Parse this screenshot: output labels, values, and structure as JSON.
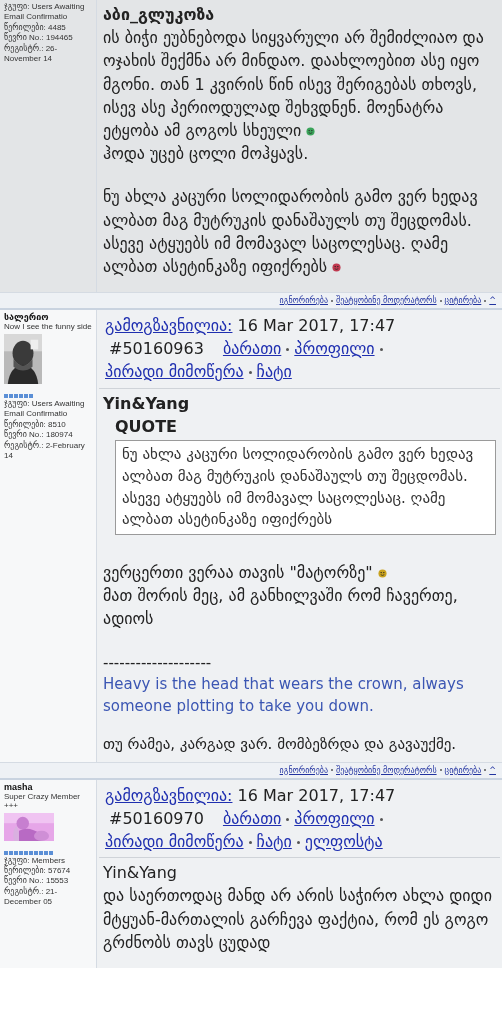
{
  "posts": [
    {
      "stats": [
        "ჯგუფი: Users Awaiting Email Confirmatio",
        "წერილები: 4485",
        "წევრი No.: 194465",
        "რეგისტრ.: 26-November 14"
      ],
      "blocks": [
        {
          "kind": "name",
          "text": "აბი_გლუკოზა"
        },
        {
          "kind": "text",
          "parts": [
            {
              "kind": "text",
              "text": "ის ბიჭი ეუბნებოდა სიყვარული არ შემიძლიაო და ოჯახის შექმნა არ მინდაო. დაახლოებით ასე იყო მგონი. თან 1 კვირის წინ ისევ შერიგებას თხოვს, ისევ ასე პერიოდულად შეხვდნენ. მოენატრა ეტყობა ამ გოგოს სხეული "
            },
            {
              "kind": "emoticon",
              "color": "#3aa35a"
            },
            {
              "kind": "break"
            },
            {
              "kind": "text",
              "text": "ჰოდა უცებ ცოლი მოჰყავს."
            }
          ]
        },
        {
          "kind": "text",
          "parts": [
            {
              "kind": "text",
              "text": "ნუ ახლა კაცური სოლიდარობის გამო ვერ ხედავ ალბათ მაგ მუტრუკის დანაშაულს თუ შეცდომას. ასევე ატყუებს იმ მომავალ საცოლესაც. ღამე ალბათ ასეტინკაზე იფიქრებს "
            },
            {
              "kind": "emoticon",
              "color": "#c0394f"
            }
          ]
        }
      ],
      "footer": [
        "იგნორირება",
        "შეატყობინე მოდერატორს",
        "ციტირება",
        "^"
      ]
    },
    {
      "author": "სალერიო",
      "member_title": "Now I see the funny side",
      "avatar": {
        "kind": "picture"
      },
      "stars": 6,
      "stats": [
        "ჯგუფი: Users Awaiting Email Confirmatio",
        "წერილები: 8510",
        "წევრი No.: 180974",
        "რეგისტრ.: 2-February 14"
      ],
      "header": {
        "label": "გამოგზავნილია:",
        "date": "16 Mar 2017, 17:47",
        "number": "#50160963",
        "links": [
          "ბარათი",
          "პროფილი",
          "პირადი მიმოწერა",
          "ჩატი"
        ]
      },
      "blocks": [
        {
          "kind": "name",
          "text": "Yin&Yang"
        },
        {
          "kind": "quote",
          "label": "QUOTE",
          "text": "ნუ ახლა კაცური სოლიდარობის გამო ვერ ხედავ ალბათ მაგ მუტრუკის დანაშაულს თუ შეცდომას. ასევე ატყუებს იმ მომავალ საცოლესაც. ღამე ალბათ ასეტინკაზე იფიქრებს"
        },
        {
          "kind": "text",
          "parts": [
            {
              "kind": "text",
              "text": "ვერცერთი ვერაა თავის \"მატორზე\" "
            },
            {
              "kind": "emoticon",
              "color": "#c9a21e"
            },
            {
              "kind": "break"
            },
            {
              "kind": "text",
              "text": "მათ შორის მეც, ამ განხილვაში რომ ჩავერთე, ადიოს"
            }
          ]
        },
        {
          "kind": "signature",
          "rule": "--------------------",
          "quote": "Heavy is the head that wears the crown, always someone plotting to take you down.",
          "note": "თუ რამეა, კარგად ვარ. მომბეზრდა და გავაუქმე."
        }
      ],
      "footer": [
        "იგნორირება",
        "შეატყობინე მოდერატორს",
        "ციტირება",
        "^"
      ]
    },
    {
      "author": "masha",
      "member_title": "Super Crazy Member +++",
      "avatar": {
        "kind": "picture"
      },
      "stars": 10,
      "stats": [
        "ჯგუფი: Members",
        "წერილები: 57674",
        "წევრი No.: 15553",
        "რეგისტრ.: 21-December 05"
      ],
      "header": {
        "label": "გამოგზავნილია:",
        "date": "16 Mar 2017, 17:47",
        "number": "#50160970",
        "links": [
          "ბარათი",
          "პროფილი",
          "პირადი მიმოწერა",
          "ჩატი",
          "ელფოსტა"
        ]
      },
      "blocks": [
        {
          "kind": "plain",
          "text": "Yin&Yang"
        },
        {
          "kind": "text",
          "parts": [
            {
              "kind": "text",
              "text": "და საერთოდაც მანდ არ არის საჭირო ახლა დიდი მტყუან-მართალის გარჩევა ფაქტია, რომ ეს გოგო გრძნობს თავს ცუდად"
            }
          ]
        }
      ]
    }
  ]
}
